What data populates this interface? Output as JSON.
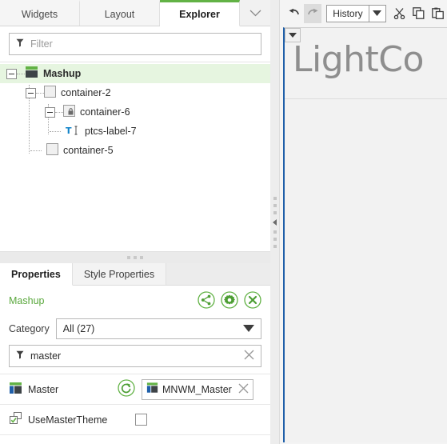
{
  "tabs": {
    "items": [
      {
        "label": "Widgets",
        "active": false
      },
      {
        "label": "Layout",
        "active": false
      },
      {
        "label": "Explorer",
        "active": true
      }
    ],
    "overflow_icon": "chevron-down-icon"
  },
  "toolbar": {
    "undo_icon": "undo-arrow-icon",
    "redo_icon": "redo-arrow-icon",
    "history_label": "History",
    "history_caret_icon": "caret-down-icon",
    "cut_icon": "scissors-icon",
    "copy_icon": "copy-icon",
    "paste_icon": "paste-icon"
  },
  "filter": {
    "icon": "funnel-icon",
    "placeholder": "Filter",
    "value": ""
  },
  "tree": {
    "nodes": [
      {
        "label": "Mashup",
        "depth": 0,
        "icon": "mashup-icon",
        "expanded": true,
        "selected": true,
        "expandable": true
      },
      {
        "label": "container-2",
        "depth": 1,
        "icon": "container-icon",
        "expanded": true,
        "selected": false,
        "expandable": true
      },
      {
        "label": "container-6",
        "depth": 2,
        "icon": "container-locked-icon",
        "expanded": true,
        "selected": false,
        "expandable": true
      },
      {
        "label": "ptcs-label-7",
        "depth": 3,
        "icon": "text-label-icon",
        "expanded": false,
        "selected": false,
        "expandable": false
      },
      {
        "label": "container-5",
        "depth": 2,
        "icon": "container-icon",
        "expanded": false,
        "selected": false,
        "expandable": false
      }
    ]
  },
  "properties": {
    "tabs": [
      {
        "label": "Properties",
        "active": true
      },
      {
        "label": "Style Properties",
        "active": false
      }
    ],
    "selected_entity": "Mashup",
    "header_buttons": [
      {
        "name": "bindings-button",
        "icon": "share-nodes-icon"
      },
      {
        "name": "configure-button",
        "icon": "gear-icon"
      },
      {
        "name": "close-button",
        "icon": "close-x-icon"
      }
    ],
    "category": {
      "label": "Category",
      "value": "All (27)",
      "caret_icon": "caret-down-icon"
    },
    "search": {
      "icon": "funnel-icon",
      "value": "master",
      "clear_icon": "close-x-icon"
    },
    "rows": [
      {
        "name": "Master",
        "icon": "master-icon",
        "refresh_icon": "refresh-circle-icon",
        "value": "MNWM_Master",
        "value_icon": "master-icon",
        "clear_icon": "close-x-icon",
        "type": "entity-picker"
      },
      {
        "name": "UseMasterTheme",
        "icon": "checkbox-property-icon",
        "checked": false,
        "type": "checkbox"
      }
    ]
  },
  "canvas": {
    "caret_icon": "caret-down-icon",
    "brand_text": "LightCo"
  },
  "splitters": {
    "horizontal_grip": "drag-dots-icon",
    "vertical_grip": "drag-dots-icon",
    "collapse_icon": "collapse-left-icon"
  },
  "colors": {
    "accent_green": "#62b245",
    "label_green": "#5aa83d",
    "selection_green": "#e6f5e0",
    "canvas_border_blue": "#1f5fa9",
    "text_icon_blue": "#0f82c8",
    "brand_gray": "#8e8e8e"
  }
}
